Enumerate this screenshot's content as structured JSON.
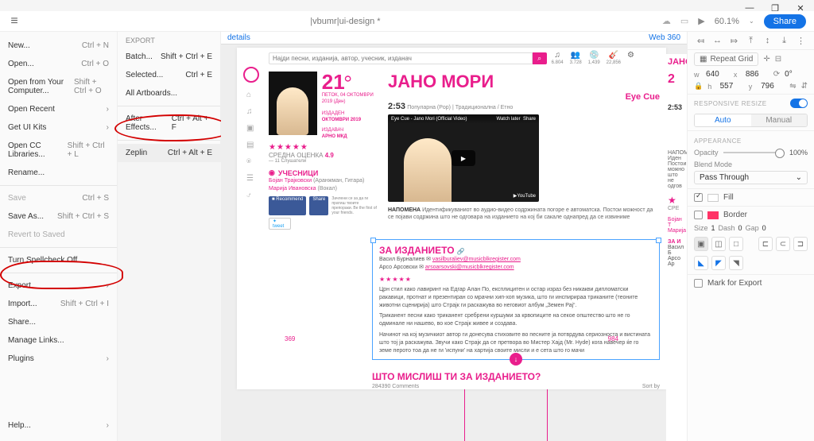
{
  "window": {
    "minimize": "—",
    "restore": "❐",
    "close": "✕"
  },
  "topbar": {
    "document_title": "|vbumr|ui-design *",
    "zoom": "60.1%",
    "share": "Share"
  },
  "file_menu": {
    "items_a": [
      {
        "label": "New...",
        "shortcut": "Ctrl + N"
      },
      {
        "label": "Open...",
        "shortcut": "Ctrl + O"
      },
      {
        "label": "Open from Your Computer...",
        "shortcut": "Shift + Ctrl + O"
      },
      {
        "label": "Open Recent",
        "shortcut": "›"
      },
      {
        "label": "Get UI Kits",
        "shortcut": "›"
      },
      {
        "label": "Open CC Libraries...",
        "shortcut": "Shift + Ctrl + L"
      },
      {
        "label": "Rename..."
      }
    ],
    "items_b": [
      {
        "label": "Save",
        "shortcut": "Ctrl + S",
        "dis": true
      },
      {
        "label": "Save As...",
        "shortcut": "Shift + Ctrl + S"
      },
      {
        "label": "Revert to Saved",
        "dis": true
      }
    ],
    "items_c": [
      {
        "label": "Turn Spellcheck Off"
      }
    ],
    "items_d": [
      {
        "label": "Export",
        "shortcut": "›"
      },
      {
        "label": "Import...",
        "shortcut": "Shift + Ctrl + I"
      },
      {
        "label": "Share..."
      },
      {
        "label": "Manage Links..."
      },
      {
        "label": "Plugins",
        "shortcut": "›"
      }
    ],
    "help": {
      "label": "Help...",
      "shortcut": "›"
    }
  },
  "export_menu": {
    "header": "EXPORT",
    "items_a": [
      {
        "label": "Batch...",
        "shortcut": "Shift + Ctrl + E"
      },
      {
        "label": "Selected...",
        "shortcut": "Ctrl + E"
      },
      {
        "label": "All Artboards..."
      }
    ],
    "items_b": [
      {
        "label": "After Effects...",
        "shortcut": "Ctrl + Alt + F"
      }
    ],
    "items_c": [
      {
        "label": "Zeplin",
        "shortcut": "Ctrl + Alt + E"
      }
    ]
  },
  "tabs": {
    "details": "details",
    "web": "Web 360"
  },
  "design": {
    "search_placeholder": "Најди песни, изданија, автор, учесник, изданач",
    "metrics": [
      {
        "icon": "♫",
        "val": "6.804"
      },
      {
        "icon": "👥",
        "val": "3.728"
      },
      {
        "icon": "💿",
        "val": "1,439"
      },
      {
        "icon": "🎸",
        "val": "22,856"
      },
      {
        "icon": "⚙",
        "val": ""
      }
    ],
    "big_number": "21",
    "deg": "⭘",
    "date_line": "ПЕТОК, 04 ОКТОМВРИ 2019 (Ден)",
    "release_lbl": "ИЗДАДЕН",
    "release_val": "ОКТОМВРИ 2019",
    "publisher_lbl": "ИЗДАВАЧ",
    "publisher_val": "АРНО МКД",
    "rating_lbl": "СРЕДНА ОЦЕНКА",
    "rating_val": "4.9",
    "rating_by": "— 11 Слушатели",
    "participants_h": "УЧЕСНИЦИ",
    "p1_name": "Бојан Трајковски",
    "p1_role": "(Аранжман, Гитара)",
    "p2_name": "Марија Ивановска",
    "p2_role": "(Вокал)",
    "fb_recommend": "■ Recommend",
    "fb_share": "Share",
    "fb_note": "Зачлени се за да ги пратиш твоите препораки. Be the first of your friends.",
    "tweet": "✦ tweet",
    "song_title": "ЈАНО МОРИ",
    "artist": "Eye Cue",
    "duration": "2:53",
    "genre": "Популарна (Pop)  |  Традиционална / Етно",
    "video_title": "Eye Cue - Jano Mori (Official Video)",
    "watch_later": "Watch later",
    "share_v": "Share",
    "note_b": "НАПОМЕНА",
    "note_txt": "Идентификуваниот во аудио-видео содржината погоре е автоматска. Постои можност да се појави содржина што не одговара на изданието на кој би сакале однапред да се извиниме",
    "za_h": "ЗА ИЗДАНИЕТО",
    "a1_name": "Васил Бурналиев",
    "a1_mail": "vasilburaliev@musicblkregister.com",
    "a2_name": "Арсо Арсовски",
    "a2_mail": "arsoarsovski@musicblkregister.com",
    "para1": "Црн стил како лавиринт на Едгар Алан По, експлицитен и остар израз без никакви дипломатски ракавици, протнат и презентиран со мрачни хип-хоп музика, што ги инспирираа триканите (теоните животни сценирија) што Страјк ги раскажува во неговиот албум „Земен Рај“.",
    "para2": "Триканент песни како триканент сребрени куршуми за крвопиците на секое општество што не го одминале ни нашево, во кое Страјк живее и создава.",
    "para3": "Начинот на кој музичкиот автор ги донесува стиховите во песните ја потврдува сериозноста и вистината што тој ја раскажува. Звучи како Страјк да се претвора во Мистер Хајд (Mr. Hyde) кога навечер ќе го земе перото тоа да не ги 'испуни' на хартија своите мисли и е сета што го мачи",
    "ruler_left": "369",
    "ruler_right": "984",
    "comments_h": "ШТО МИСЛИШ ТИ ЗА ИЗДАНИЕТО?",
    "comments_count": "284390 Comments",
    "sort_by": "Sort by"
  },
  "peek": {
    "t1": "JAHO",
    "t2": "2",
    "t3": "2:53",
    "n1": "НАПОМЕНА Иден",
    "n2": "Постои можно",
    "n3": "што не одгов",
    "star": "★",
    "b1": "СРЕ",
    "p1": "Бојан Т",
    "p2": "Марија",
    "za": "ЗА И",
    "a1": "Васил Б",
    "a2": "Арсо Ар"
  },
  "props": {
    "repeat_grid": "Repeat Grid",
    "w": "640",
    "x": "886",
    "rot": "0°",
    "h": "557",
    "y": "796",
    "resp_h": "RESPONSIVE RESIZE",
    "auto": "Auto",
    "manual": "Manual",
    "app_h": "APPEARANCE",
    "opacity_lbl": "Opacity",
    "opacity_val": "100%",
    "blend_lbl": "Blend Mode",
    "blend_val": "Pass Through",
    "fill": "Fill",
    "border": "Border",
    "size_lbl": "Size",
    "size_val": "1",
    "dash_lbl": "Dash",
    "dash_val": "0",
    "gap_lbl": "Gap",
    "gap_val": "0",
    "mark_export": "Mark for Export"
  }
}
